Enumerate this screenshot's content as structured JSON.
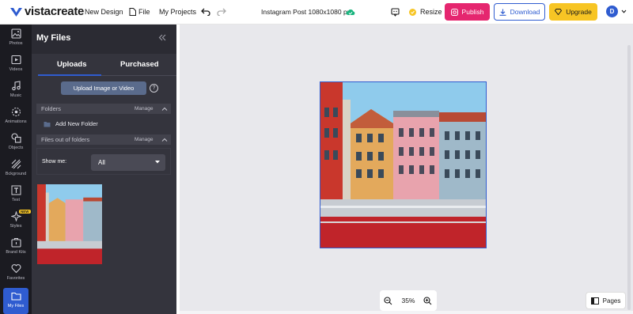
{
  "app": {
    "logo_text": "vistacreate"
  },
  "topbar": {
    "new_design": "New Design",
    "file": "File",
    "my_projects": "My Projects",
    "doc_title": "Instagram Post 1080x1080 px",
    "resize": "Resize",
    "publish": "Publish",
    "download": "Download",
    "upgrade": "Upgrade",
    "avatar_initial": "D"
  },
  "rail": {
    "items": [
      {
        "label": "Photos",
        "icon": "photos-icon"
      },
      {
        "label": "Videos",
        "icon": "videos-icon"
      },
      {
        "label": "Music",
        "icon": "music-icon"
      },
      {
        "label": "Animations",
        "icon": "animations-icon"
      },
      {
        "label": "Objects",
        "icon": "objects-icon"
      },
      {
        "label": "Bckground",
        "icon": "background-icon"
      },
      {
        "label": "Text",
        "icon": "text-icon"
      },
      {
        "label": "Styles",
        "icon": "styles-icon",
        "badge": "NEW"
      },
      {
        "label": "Brand Kits",
        "icon": "brand-kits-icon"
      },
      {
        "label": "Favorites",
        "icon": "heart-icon"
      },
      {
        "label": "My Files",
        "icon": "folder-icon",
        "active": true
      }
    ]
  },
  "panel": {
    "title": "My Files",
    "tabs": {
      "uploads": "Uploads",
      "purchased": "Purchased"
    },
    "upload_button": "Upload Image or Video",
    "help": "?",
    "folders": {
      "label": "Folders",
      "manage": "Manage"
    },
    "add_folder": "Add New Folder",
    "files_out": {
      "label": "Files out of folders",
      "manage": "Manage"
    },
    "show_me": {
      "label": "Show me:",
      "value": "All"
    }
  },
  "canvas": {
    "zoom": "35%",
    "pages": "Pages"
  },
  "colors": {
    "accent": "#2f5cd0",
    "publish": "#e5266f",
    "upgrade": "#f7c524",
    "rail_bg": "#1b1b21",
    "panel_bg": "#2b2b33"
  }
}
